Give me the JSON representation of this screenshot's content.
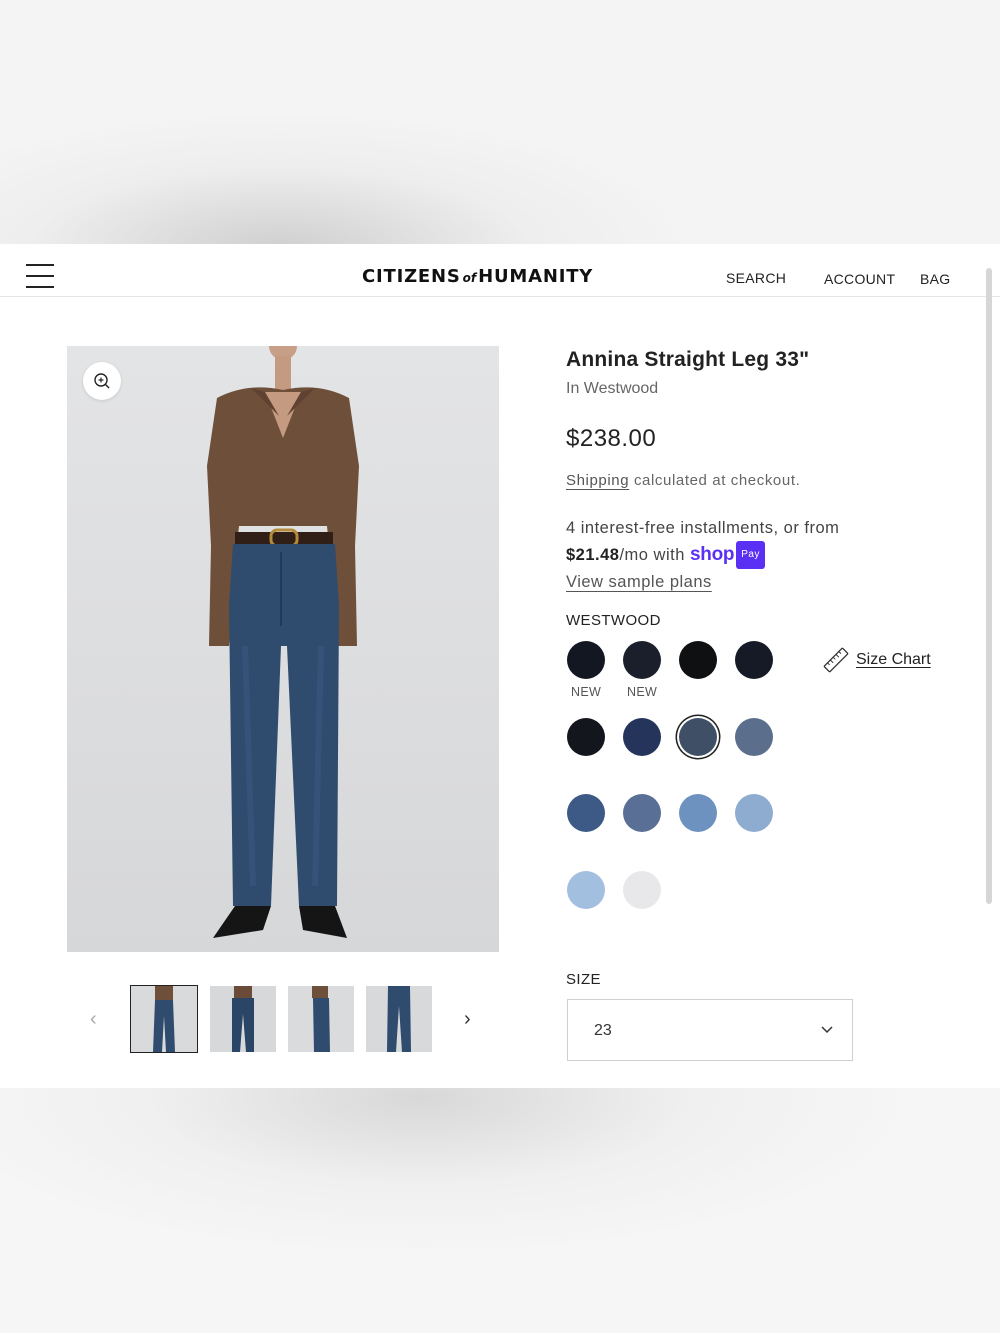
{
  "header": {
    "logo_left": "CITIZENS",
    "logo_of": "of",
    "logo_right": "HUMANITY",
    "nav": [
      "SEARCH",
      "ACCOUNT",
      "BAG"
    ]
  },
  "gallery": {
    "thumbnail_count": 4,
    "active_thumbnail": 1
  },
  "product": {
    "title": "Annina Straight Leg 33\"",
    "subtitle": "In Westwood",
    "price": "$238.00",
    "shipping_link": "Shipping",
    "shipping_rest": " calculated at checkout.",
    "installments_text": "4 interest-free installments, or from",
    "installment_amount": "$21.48",
    "installment_suffix": "/mo with",
    "shop_logo": "shop",
    "pay_badge": "Pay",
    "sample_plans": "View sample plans"
  },
  "color": {
    "label": "WESTWOOD",
    "selected_index": 6,
    "swatches": [
      {
        "color": "#121722",
        "tag": "NEW"
      },
      {
        "color": "#1a1f2b",
        "tag": "NEW"
      },
      {
        "color": "#0f1012",
        "tag": ""
      },
      {
        "color": "#161a26",
        "tag": ""
      },
      {
        "color": "#14161d",
        "tag": ""
      },
      {
        "color": "#25345a",
        "tag": ""
      },
      {
        "color": "#3f5066",
        "tag": ""
      },
      {
        "color": "#5b6f8c",
        "tag": ""
      },
      {
        "color": "#3c5a85",
        "tag": ""
      },
      {
        "color": "#5a6f96",
        "tag": ""
      },
      {
        "color": "#6d92c0",
        "tag": ""
      },
      {
        "color": "#8eacd0",
        "tag": ""
      },
      {
        "color": "#a3bfdf",
        "tag": ""
      },
      {
        "color": "#e8e8ea",
        "tag": ""
      }
    ],
    "size_chart_label": "Size Chart"
  },
  "size": {
    "label": "SIZE",
    "selected": "23"
  },
  "icons": {
    "menu": "menu-icon",
    "zoom": "zoom-in-icon",
    "prev": "chevron-left-icon",
    "next": "chevron-right-icon",
    "ruler": "ruler-icon",
    "dropdown": "chevron-down-icon"
  }
}
